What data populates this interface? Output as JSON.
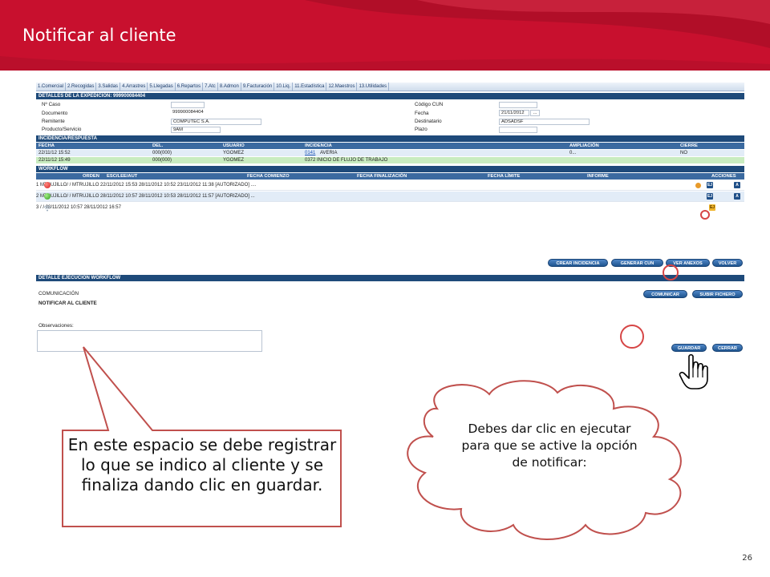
{
  "slide": {
    "title": "Notificar al cliente",
    "page_number": "26"
  },
  "app": {
    "menu": [
      "1.Comercial",
      "2.Recogidas",
      "3.Salidas",
      "4.Arrastres",
      "5.Llegadas",
      "6.Repartos",
      "7.Atc",
      "8.Admon",
      "9.Facturación",
      "10.Liq.",
      "11.Estadística",
      "12.Maestros",
      "13.Utilidades"
    ],
    "details_header": "DETALLES DE LA EXPEDICIÓN: 999900084404",
    "details": {
      "caso_label": "Nº Caso",
      "caso_value": "",
      "documento_label": "Documento",
      "documento_value": "999900084404",
      "remitente_label": "Remitente",
      "remitente_value": "COMPUTEC S.A.",
      "producto_label": "Producto/Servicio",
      "producto_value": "9AM",
      "cun_label": "Código CUN",
      "cun_value": "",
      "fecha_label": "Fecha",
      "fecha_value": "21/11/2012",
      "fecha_btn": "...",
      "destinatario_label": "Destinatario",
      "destinatario_value": "ADSADSF",
      "plazo_label": "Plazo",
      "plazo_value": ""
    },
    "incidencia_header": "INCIDENCIA/RESPUESTA",
    "incidencia_columns": [
      "FECHA",
      "DEL.",
      "USUARIO",
      "INCIDENCIA",
      "AMPLIACIÓN",
      "CIERRE"
    ],
    "incidencia_rows": [
      {
        "fecha": "22/11/12 15:52",
        "del": "000(000)",
        "usuario": "YGOMEZ",
        "code": "0141",
        "incidencia": "AVERIA",
        "ampliacion": "0...",
        "cierre": "NO"
      },
      {
        "fecha": "22/11/12 15:49",
        "del": "000(000)",
        "usuario": "YGOMEZ",
        "code": "",
        "incidencia": "0372 INICIO DE FLUJO DE TRABAJO",
        "ampliacion": "",
        "cierre": ""
      }
    ],
    "workflow_header": "WORKFLOW",
    "workflow_columns": [
      "ORDEN",
      "ESC/LEE/AUT",
      "FECHA COMIENZO",
      "FECHA FINALIZACIÓN",
      "FECHA LÍMITE",
      "INFORME",
      "ACCIONES"
    ],
    "workflow_rows": [
      {
        "orden": "1",
        "esc": "MTRUJILLO/ / MTRUJILLO",
        "comienzo": "22/11/2012 15:53",
        "fin": "28/11/2012 10:52",
        "limite": "23/11/2012 11:38",
        "informe": "[AUTORIZADO] ....",
        "status": "red"
      },
      {
        "orden": "2",
        "esc": "MTRUJILLO/ / MTRUJILLO",
        "comienzo": "28/11/2012 10:57",
        "fin": "28/11/2012 10:53",
        "limite": "28/11/2012 11:57",
        "informe": "[AUTORIZADO] ...",
        "status": "green"
      },
      {
        "orden": "3",
        "esc": "/ /",
        "comienzo": "28/11/2012 10:57",
        "fin": "",
        "limite": "28/11/2012 16:57",
        "informe": "",
        "status": "pending"
      }
    ],
    "action_ej": "EJ",
    "action_a": "A",
    "buttons": {
      "crear": "CREAR INCIDENCIA",
      "generar": "GENERAR CUN",
      "ver": "VER ANEXOS",
      "volver": "VOLVER",
      "comunicar": "COMUNICAR",
      "subir": "SUBIR FICHERO",
      "guardar": "GUARDAR",
      "cerrar": "CERRAR"
    },
    "detalle_header": "DETALLE EJECUCIÓN WORKFLOW",
    "comunicacion_label": "COMUNICACIÓN",
    "notificar_label": "NOTIFICAR AL CLIENTE",
    "observaciones_label": "Observaciones:"
  },
  "callouts": {
    "left": "En este espacio se debe registrar lo que se indico al cliente y se finaliza dando clic en guardar.",
    "cloud": "Debes  dar clic en ejecutar  para que se active la opción de notificar:"
  },
  "colors": {
    "brand_red": "#c8102e",
    "header_blue": "#1e4a7a",
    "ring_red": "#d64545"
  }
}
